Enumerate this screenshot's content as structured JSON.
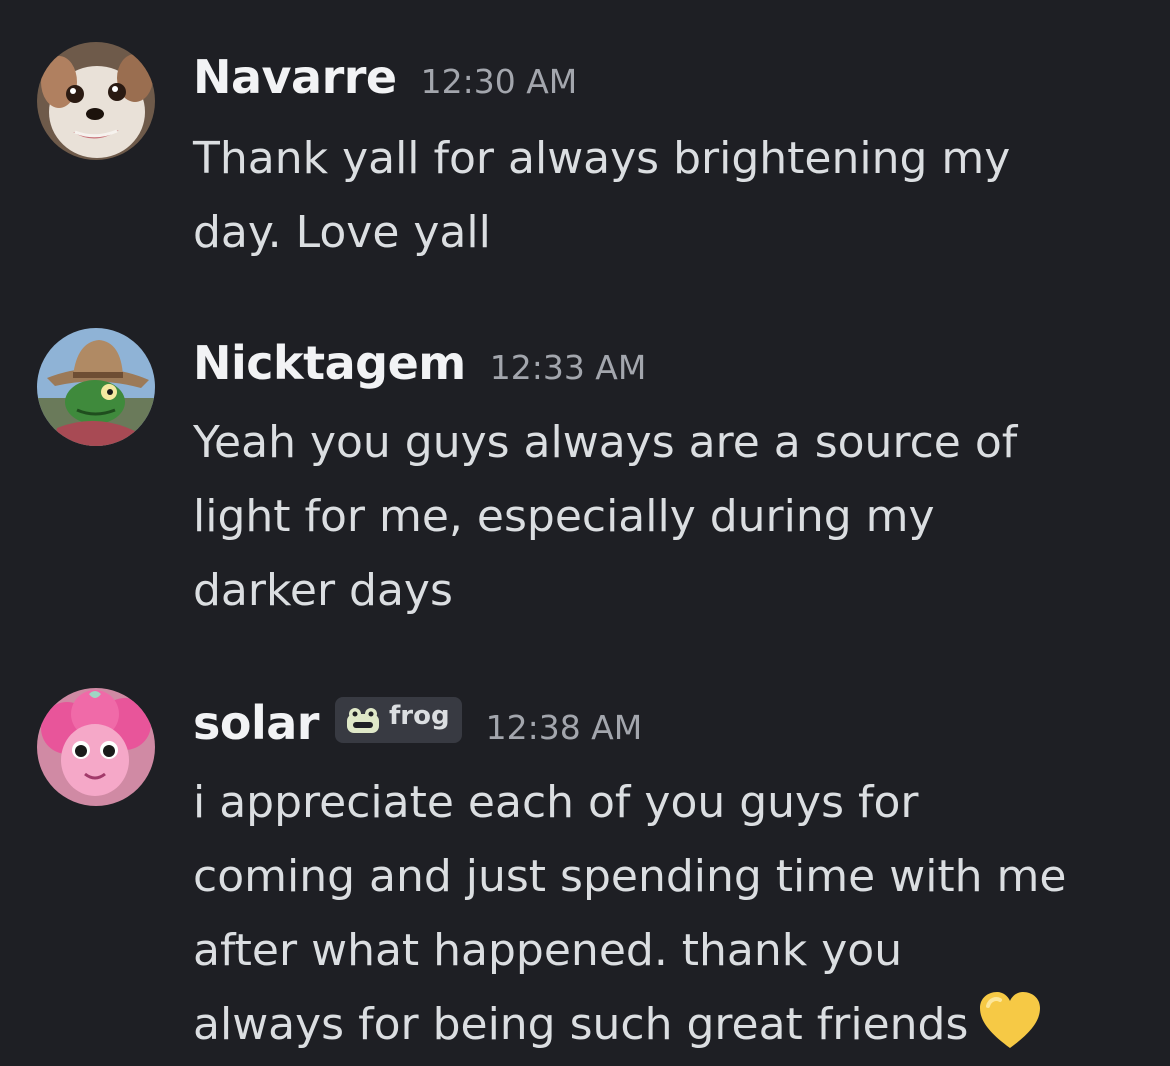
{
  "messages": [
    {
      "username": "Navarre",
      "timestamp": "12:30 AM",
      "avatar_icon": "dog-avatar",
      "lines": [
        "Thank yall for always brightening my",
        "day. Love yall"
      ]
    },
    {
      "username": "Nicktagem",
      "timestamp": "12:33 AM",
      "avatar_icon": "frog-cowboy-avatar",
      "lines": [
        "Yeah you guys always are a source of",
        "light for me, especially during my",
        "darker days"
      ]
    },
    {
      "username": "solar",
      "timestamp": "12:38 AM",
      "avatar_icon": "pink-pony-avatar",
      "tag": {
        "label": "frog",
        "icon": "frog-tag-icon"
      },
      "lines": [
        "i appreciate each of you guys for",
        "coming and just spending time with me",
        "after what happened. thank you",
        "always for being such great friends"
      ],
      "emoji": "yellow-heart-emoji"
    }
  ],
  "colors": {
    "background": "#1e1f24",
    "username": "#f2f3f5",
    "timestamp": "#a3a6ad",
    "body_text": "#dbdee1",
    "tag_background": "#383a42",
    "heart": "#f6c945"
  }
}
